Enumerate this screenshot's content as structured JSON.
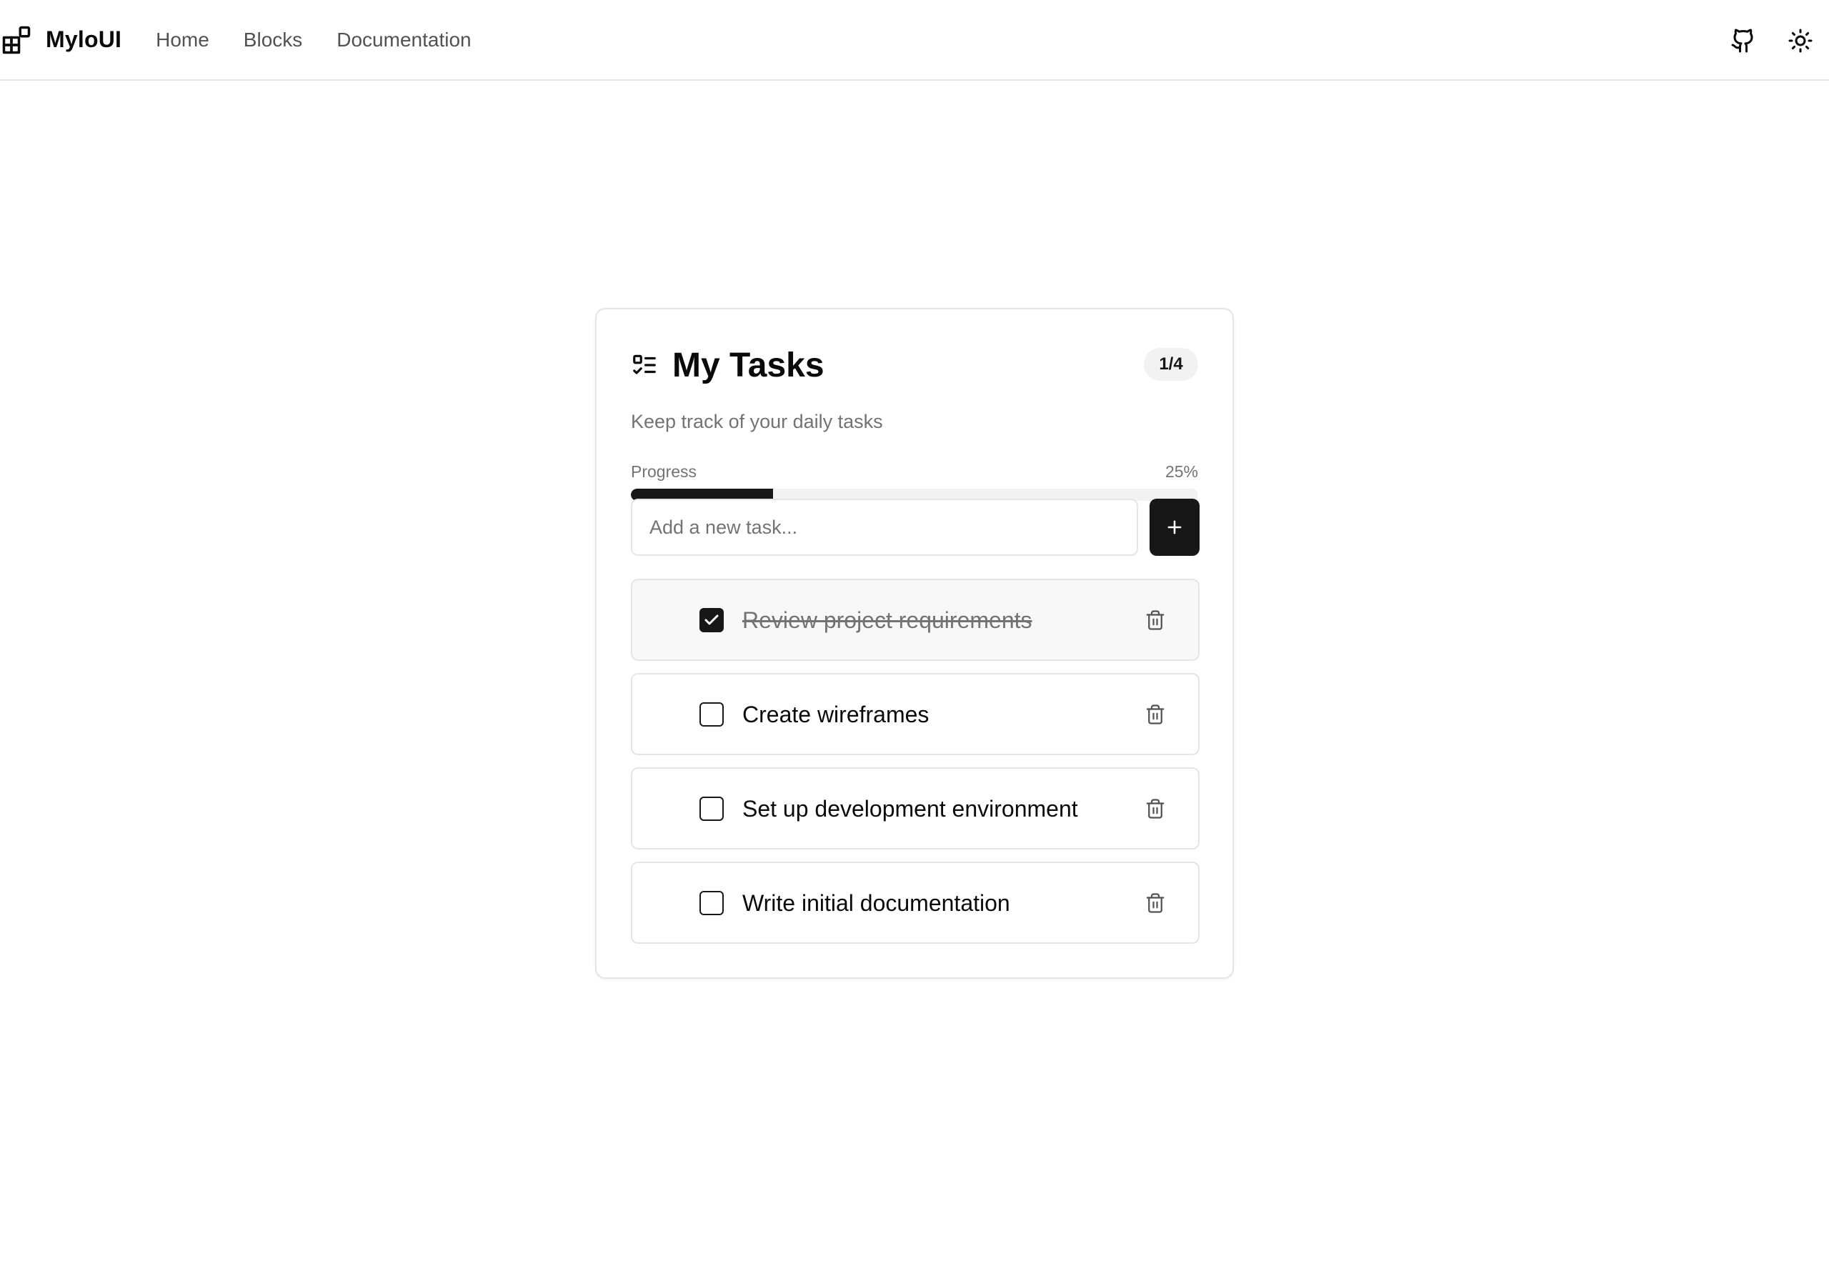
{
  "header": {
    "brand": "MyloUI",
    "nav": [
      "Home",
      "Blocks",
      "Documentation"
    ],
    "icons": [
      "github-icon",
      "sun-icon"
    ]
  },
  "card": {
    "title": "My Tasks",
    "subtitle": "Keep track of your daily tasks",
    "count": "1/4",
    "progress": {
      "label": "Progress",
      "value_text": "25%",
      "fraction": 0.25
    },
    "input": {
      "placeholder": "Add a new task...",
      "value": ""
    },
    "add_icon": "plus-icon"
  },
  "tasks": [
    {
      "label": "Review project requirements",
      "done": true
    },
    {
      "label": "Create wireframes",
      "done": false
    },
    {
      "label": "Set up development environment",
      "done": false
    },
    {
      "label": "Write initial documentation",
      "done": false
    }
  ],
  "colors": {
    "accent": "#171717",
    "muted_text": "#737373",
    "border": "#e5e5e5",
    "track": "#f2f2f2"
  }
}
